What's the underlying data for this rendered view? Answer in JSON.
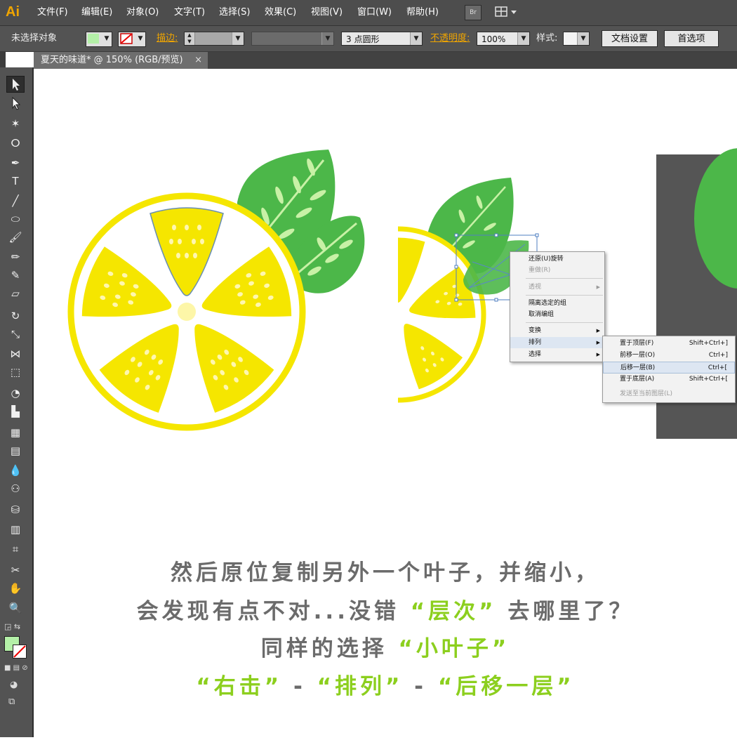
{
  "app": {
    "logo": "Ai",
    "br_button": "Br",
    "arrange_icon": "workspace-arrange-icon"
  },
  "menubar": {
    "items": [
      "文件(F)",
      "编辑(E)",
      "对象(O)",
      "文字(T)",
      "选择(S)",
      "效果(C)",
      "视图(V)",
      "窗口(W)",
      "帮助(H)"
    ]
  },
  "controlbar": {
    "selection_label": "未选择对象",
    "fill_color": "#b4f0a8",
    "stroke_label": "描边:",
    "brush_value": "3 点圆形",
    "opacity_label": "不透明度:",
    "opacity_value": "100%",
    "style_label": "样式:",
    "doc_setup_button": "文档设置",
    "preferences_button": "首选项"
  },
  "document_tab": {
    "title": "夏天的味道* @ 150% (RGB/预览)",
    "close_glyph": "×"
  },
  "colors": {
    "lemon": "#f5e600",
    "leaf_dark": "#4cb749",
    "leaf_light": "#c8f1a6",
    "highlight_green": "#8ccf1e",
    "caption_gray": "#6b6b6b",
    "dark_panel": "#555555"
  },
  "context_menu": {
    "items": [
      {
        "label": "还原(U)旋转",
        "disabled": false,
        "submenu": false
      },
      {
        "label": "重做(R)",
        "disabled": true,
        "submenu": false
      },
      {
        "label": "透视",
        "disabled": true,
        "submenu": true
      },
      {
        "label": "隔离选定的组",
        "disabled": false,
        "submenu": false
      },
      {
        "label": "取消编组",
        "disabled": false,
        "submenu": false
      },
      {
        "label": "变换",
        "disabled": false,
        "submenu": true
      },
      {
        "label": "排列",
        "disabled": false,
        "submenu": true,
        "highlighted": true
      },
      {
        "label": "选择",
        "disabled": false,
        "submenu": true
      }
    ]
  },
  "arrange_submenu": {
    "items": [
      {
        "label": "置于顶层(F)",
        "shortcut": "Shift+Ctrl+]"
      },
      {
        "label": "前移一层(O)",
        "shortcut": "Ctrl+]"
      },
      {
        "label": "后移一层(B)",
        "shortcut": "Ctrl+[",
        "highlighted": true
      },
      {
        "label": "置于底层(A)",
        "shortcut": "Shift+Ctrl+["
      },
      {
        "label": "发送至当前图层(L)",
        "shortcut": "",
        "disabled": true
      }
    ]
  },
  "caption": {
    "line1": "然后原位复制另外一个叶子，并缩小，",
    "line2_a": "会发现有点不对...没错",
    "line2_b": "“层次”",
    "line2_c": "去哪里了？",
    "line3_a": "同样的选择",
    "line3_b": "“小叶子”",
    "line4_a": "“右击”",
    "line4_dash1": "-",
    "line4_b": "“排列”",
    "line4_dash2": "-",
    "line4_c": "“后移一层”"
  }
}
